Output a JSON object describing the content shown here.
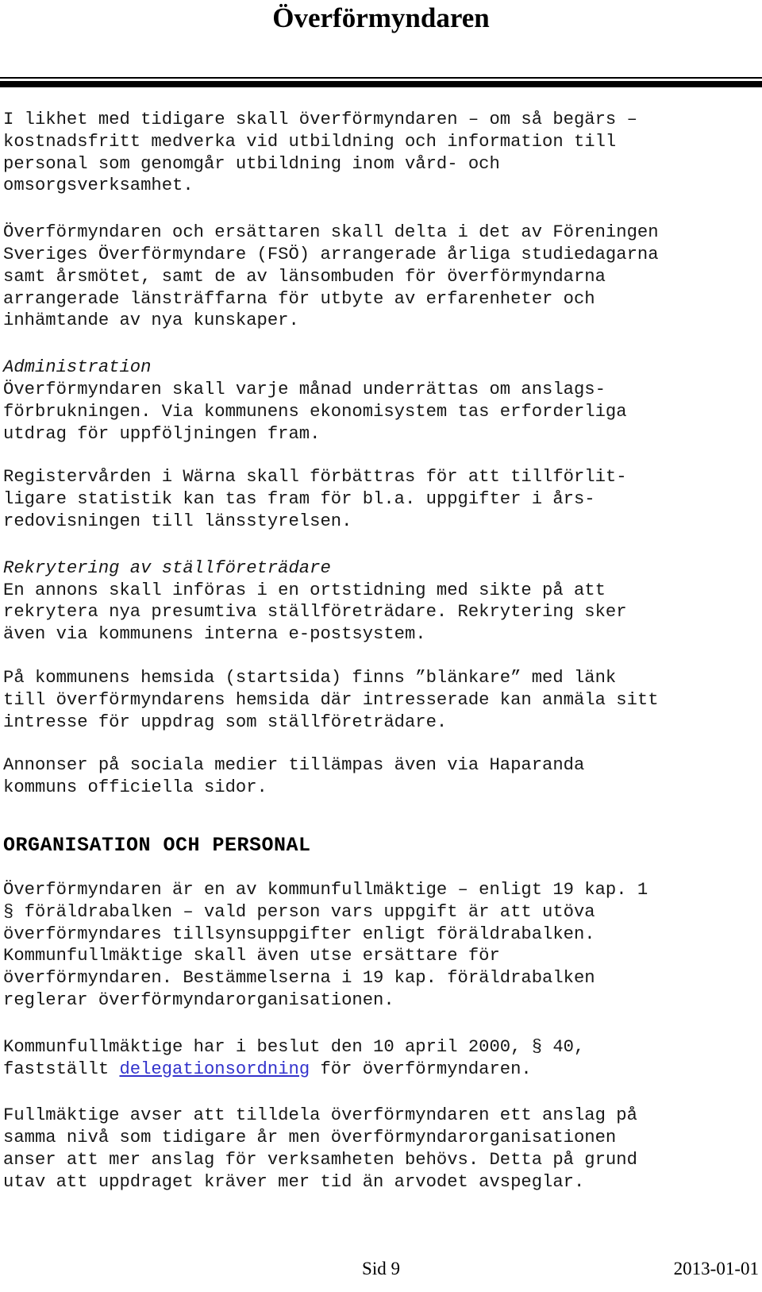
{
  "document": {
    "title": "Överförmyndaren",
    "paragraphs": {
      "p1": "I likhet med tidigare skall överförmyndaren – om så begärs –\nkostnadsfritt medverka vid utbildning och information till\npersonal som genomgår utbildning inom vård- och\nomsorgsverksamhet.",
      "p2": "Överförmyndaren och ersättaren skall delta i det av Föreningen\nSveriges Överförmyndare (FSÖ) arrangerade årliga studiedagarna\nsamt årsmötet, samt de av länsombuden för överförmyndarna\narrangerade länsträffarna för utbyte av erfarenheter och\ninhämtande av nya kunskaper.",
      "heading_administration": "Administration",
      "p3": "Överförmyndaren skall varje månad underrättas om anslags-\nförbrukningen. Via kommunens ekonomisystem tas erforderliga\nutdrag för uppföljningen fram.",
      "p4": "Registervården i Wärna skall förbättras för att tillförlit-\nligare statistik kan tas fram för bl.a. uppgifter i års-\nredovisningen till länsstyrelsen.",
      "heading_rekrytering": "Rekrytering av ställföreträdare",
      "p5": "En annons skall införas i en ortstidning med sikte på att\nrekrytera nya presumtiva ställföreträdare. Rekrytering sker\näven via kommunens interna e-postsystem.",
      "p6": "På kommunens hemsida (startsida) finns ”blänkare” med länk\ntill överförmyndarens hemsida där intresserade kan anmäla sitt\nintresse för uppdrag som ställföreträdare.",
      "p7": "Annonser på sociala medier tillämpas även via Haparanda\nkommuns officiella sidor.",
      "heading_organisation": "ORGANISATION OCH PERSONAL",
      "p8": "Överförmyndaren är en av kommunfullmäktige – enligt 19 kap. 1\n§ föräldrabalken – vald person vars uppgift är att utöva\növerförmyndares tillsynsuppgifter enligt föräldrabalken.\nKommunfullmäktige skall även utse ersättare för\növerförmyndaren. Bestämmelserna i 19 kap. föräldrabalken\nreglerar överförmyndarorganisationen.",
      "p9_before_link": "Kommunfullmäktige har i beslut den 10 april 2000, § 40,\nfastställt ",
      "p9_link": "delegationsordning",
      "p9_after_link": " för överförmyndaren.",
      "p10": "Fullmäktige avser att tilldela överförmyndaren ett anslag på\nsamma nivå som tidigare år men överförmyndarorganisationen\nanser att mer anslag för verksamheten behövs. Detta på grund\nutav att uppdraget kräver mer tid än arvodet avspeglar."
    },
    "footer": {
      "page_label": "Sid 9",
      "date": "2013-01-01"
    },
    "colors": {
      "text": "#171717",
      "heading": "#000000",
      "link": "#3333cc",
      "rule": "#000000",
      "background": "#ffffff"
    }
  }
}
